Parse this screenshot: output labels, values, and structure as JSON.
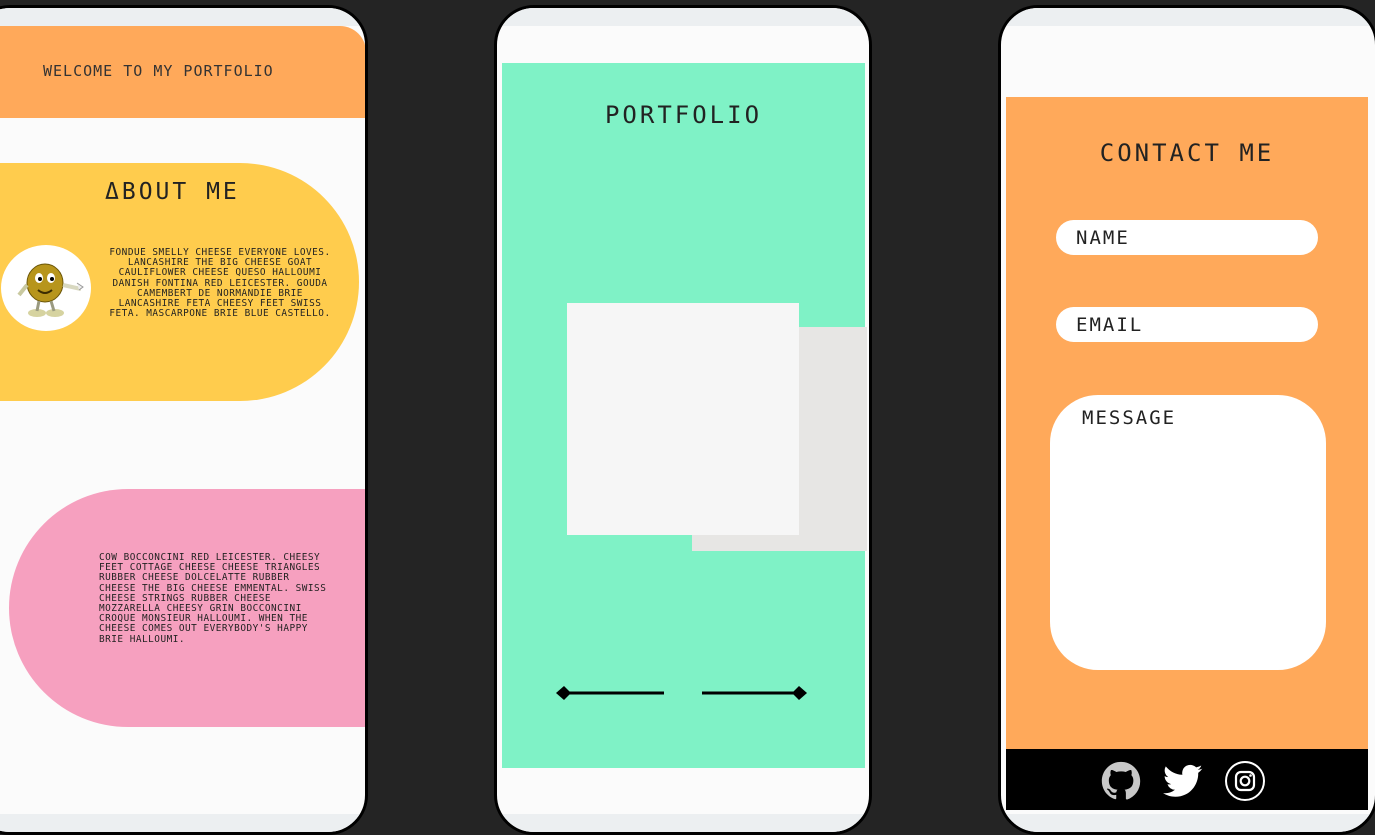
{
  "welcome": {
    "text": "WELCOME TO MY PORTFOLIO"
  },
  "about": {
    "title": "ΔBOUT ME",
    "text": "Fondue smelly cheese everyone loves. Lancashire the big cheese goat cauliflower cheese queso halloumi danish fontina red leicester. Gouda camembert de normandie brie lancashire feta cheesy feet swiss feta. Mascarpone brie blue castello."
  },
  "second_section": {
    "text": "Cow bocconcini red leicester. Cheesy feet cottage cheese cheese triangles rubber cheese dolcelatte rubber cheese the big cheese emmental. Swiss cheese strings rubber cheese mozzarella cheesy grin bocconcini croque monsieur halloumi. When the cheese comes out everybody's happy brie halloumi."
  },
  "portfolio": {
    "title": "PORTFOLIO"
  },
  "contact": {
    "title": "CONTACT ME",
    "name_placeholder": "NAME",
    "email_placeholder": "EMAIL",
    "message_placeholder": "MESSAGE"
  },
  "social": [
    "github-icon",
    "twitter-icon",
    "instagram-icon"
  ],
  "colors": {
    "orange": "#ffa95a",
    "yellow": "#ffcc4d",
    "pink": "#f6a0bf",
    "mint": "#7ff2c6",
    "background": "#242424"
  }
}
